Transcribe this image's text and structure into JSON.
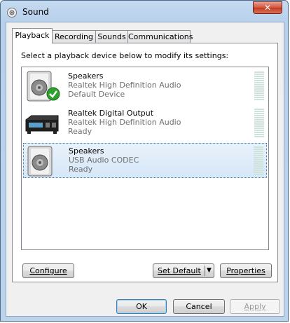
{
  "window": {
    "title": "Sound"
  },
  "tabs": [
    {
      "label": "Playback",
      "active": true
    },
    {
      "label": "Recording",
      "active": false
    },
    {
      "label": "Sounds",
      "active": false
    },
    {
      "label": "Communications",
      "active": false
    }
  ],
  "panel": {
    "instruction": "Select a playback device below to modify its settings:",
    "devices": [
      {
        "name": "Speakers",
        "description": "Realtek High Definition Audio",
        "status": "Default Device",
        "icon": "speaker-icon",
        "is_default": true,
        "selected": false
      },
      {
        "name": "Realtek Digital Output",
        "description": "Realtek High Definition Audio",
        "status": "Ready",
        "icon": "digital-output-icon",
        "is_default": false,
        "selected": false
      },
      {
        "name": "Speakers",
        "description": "USB Audio CODEC",
        "status": "Ready",
        "icon": "speaker-icon",
        "is_default": false,
        "selected": true
      }
    ],
    "configure_label": "Configure",
    "set_default_label": "Set Default",
    "properties_label": "Properties"
  },
  "footer": {
    "ok_label": "OK",
    "cancel_label": "Cancel",
    "apply_label": "Apply"
  },
  "colors": {
    "accent": "#3c7fb1",
    "default_check": "#2fa12f",
    "close": "#c23a1f"
  }
}
